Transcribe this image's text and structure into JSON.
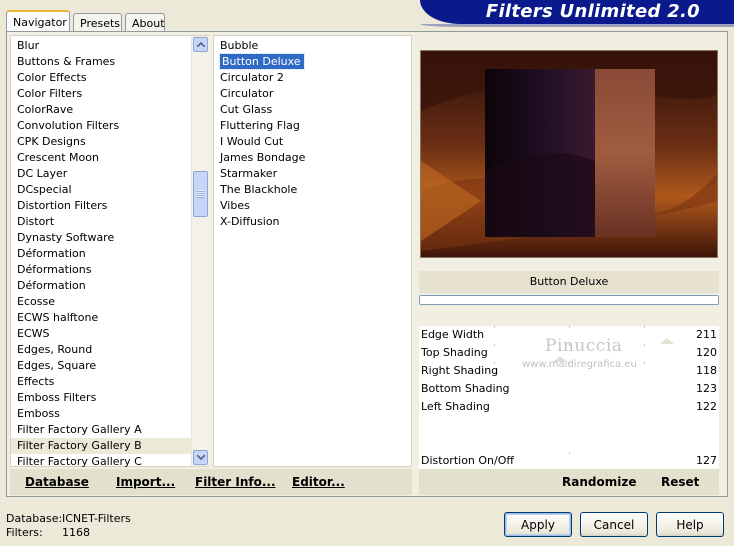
{
  "app": {
    "title": "Filters Unlimited 2.0"
  },
  "tabs": [
    {
      "label": "Navigator",
      "active": true
    },
    {
      "label": "Presets",
      "active": false
    },
    {
      "label": "About",
      "active": false
    }
  ],
  "categories": {
    "items": [
      "Blur",
      "Buttons & Frames",
      "Color Effects",
      "Color Filters",
      "ColorRave",
      "Convolution Filters",
      "CPK Designs",
      "Crescent Moon",
      "DC Layer",
      "DCspecial",
      "Distortion Filters",
      "Distort",
      "Dynasty Software",
      "Déformation",
      "Déformations",
      "Déformation",
      "Ecosse",
      "ECWS halftone",
      "ECWS",
      "Edges, Round",
      "Edges, Square",
      "Effects",
      "Emboss Filters",
      "Emboss",
      "Filter Factory Gallery A",
      "Filter Factory Gallery B",
      "Filter Factory Gallery C"
    ],
    "highlighted": "Filter Factory Gallery B"
  },
  "filters": {
    "items": [
      "Bubble",
      "Button Deluxe",
      "Circulator 2",
      "Circulator",
      "Cut Glass",
      "Fluttering Flag",
      "I Would Cut",
      "James Bondage",
      "Starmaker",
      "The Blackhole",
      "Vibes",
      "X-Diffusion"
    ],
    "selected": "Button Deluxe"
  },
  "left_bar": {
    "database_label": "Database",
    "import_label": "Import...",
    "filter_info_label": "Filter Info...",
    "editor_label": "Editor..."
  },
  "preview": {
    "caption": "Button Deluxe"
  },
  "params": [
    {
      "name": "Edge Width",
      "value": "211"
    },
    {
      "name": "Top Shading",
      "value": "120"
    },
    {
      "name": "Right Shading",
      "value": "118"
    },
    {
      "name": "Bottom Shading",
      "value": "123"
    },
    {
      "name": "Left Shading",
      "value": "122"
    },
    {
      "name": "Distortion On/Off",
      "value": "127"
    }
  ],
  "right_bar": {
    "randomize_label": "Randomize",
    "reset_label": "Reset"
  },
  "watermark": {
    "name": "Pinuccia",
    "url": "www.maidiregrafica.eu"
  },
  "status": {
    "database_label": "Database:",
    "database_value": "ICNET-Filters",
    "filters_label": "Filters:",
    "filters_value": "1168"
  },
  "buttons": {
    "apply": "Apply",
    "cancel": "Cancel",
    "help": "Help"
  },
  "colors": {
    "header_bg": "#0a1a8c",
    "selection": "#316ac5",
    "tab_accent": "#f0b43c"
  }
}
